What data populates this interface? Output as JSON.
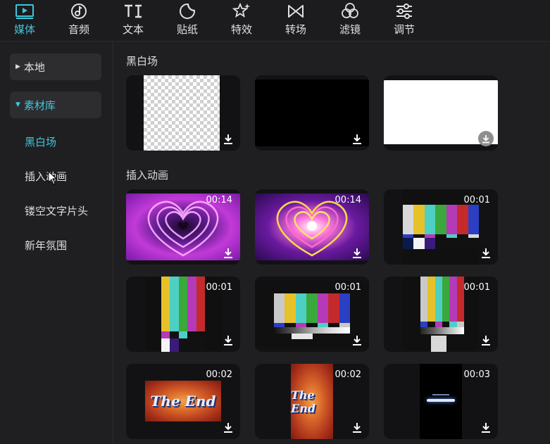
{
  "tabs": [
    {
      "label": "媒体",
      "icon": "media-play-icon",
      "active": true
    },
    {
      "label": "音频",
      "icon": "music-note-icon",
      "active": false
    },
    {
      "label": "文本",
      "icon": "text-ti-icon",
      "active": false
    },
    {
      "label": "贴纸",
      "icon": "sticker-icon",
      "active": false
    },
    {
      "label": "特效",
      "icon": "effects-star-icon",
      "active": false
    },
    {
      "label": "转场",
      "icon": "transition-bowtie-icon",
      "active": false
    },
    {
      "label": "滤镜",
      "icon": "filter-circles-icon",
      "active": false
    },
    {
      "label": "调节",
      "icon": "adjust-sliders-icon",
      "active": false
    }
  ],
  "sidebar": {
    "folders": [
      {
        "label": "本地",
        "expanded": false
      },
      {
        "label": "素材库",
        "expanded": true
      }
    ],
    "items": [
      {
        "label": "黑白场",
        "active": true
      },
      {
        "label": "插入动画",
        "active": false
      },
      {
        "label": "镂空文字片头",
        "active": false
      },
      {
        "label": "新年氛围",
        "active": false
      }
    ]
  },
  "sections": [
    {
      "title": "黑白场"
    },
    {
      "title": "插入动画"
    }
  ],
  "cards": [
    {
      "kind": "transparent",
      "duration": ""
    },
    {
      "kind": "black",
      "duration": ""
    },
    {
      "kind": "white",
      "duration": ""
    },
    {
      "kind": "heart-1",
      "duration": "00:14"
    },
    {
      "kind": "heart-2",
      "duration": "00:14"
    },
    {
      "kind": "colorbars-wide",
      "duration": "00:01"
    },
    {
      "kind": "colorbars-tall",
      "duration": "00:01"
    },
    {
      "kind": "colorbars-mid",
      "duration": "00:01"
    },
    {
      "kind": "colorbars-narrow",
      "duration": "00:01"
    },
    {
      "kind": "theend-wide",
      "duration": "00:02",
      "text": "The End"
    },
    {
      "kind": "theend-tall",
      "duration": "00:02",
      "text": "The End"
    },
    {
      "kind": "loading",
      "duration": "00:03"
    }
  ],
  "colors": {
    "accent": "#3fc6d8",
    "bars": [
      "#c9c9c9",
      "#e6c12a",
      "#4ecfc4",
      "#3aa83c",
      "#b43ab8",
      "#c42a2a",
      "#2a3fc4"
    ]
  }
}
